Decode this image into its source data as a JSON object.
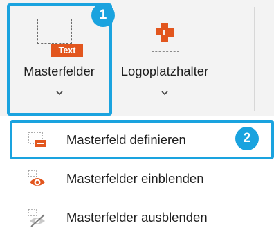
{
  "ribbon": {
    "masterfelder_label": "Masterfelder",
    "masterfelder_icon_tag": "Text",
    "logo_label": "Logoplatzhalter"
  },
  "callouts": {
    "badge_1": "1",
    "badge_2": "2"
  },
  "menu": {
    "items": [
      {
        "label": "Masterfeld definieren",
        "icon": "masterfield-define-icon"
      },
      {
        "label": "Masterfelder einblenden",
        "icon": "show-eye-icon"
      },
      {
        "label": "Masterfelder ausblenden",
        "icon": "hide-eye-icon"
      }
    ]
  },
  "colors": {
    "accent_orange": "#e2561e",
    "highlight_blue": "#1aa3df"
  }
}
